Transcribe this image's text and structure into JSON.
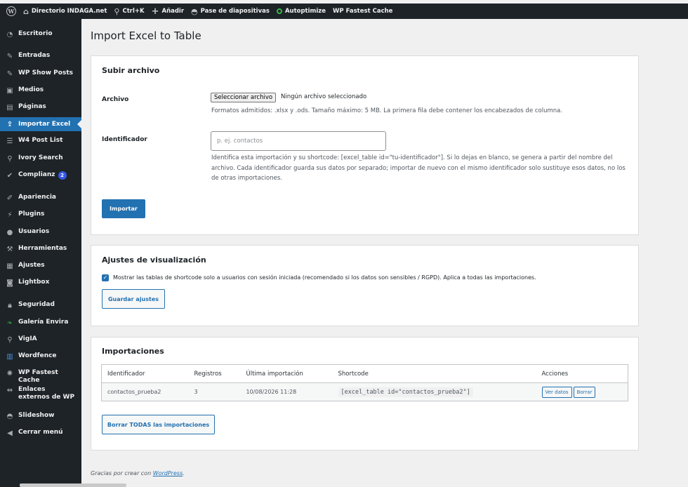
{
  "admin_bar": {
    "items": [
      {
        "icon": "home-icon",
        "label": "Directorio INDAGA.net"
      },
      {
        "icon": "search-icon",
        "label": "Ctrl+K"
      },
      {
        "icon": "plus-icon",
        "label": "Añadir"
      },
      {
        "icon": "slideshow-icon",
        "label": "Pase de diapositivas"
      },
      {
        "icon": "circle-icon",
        "label": "Autoptimize"
      },
      {
        "icon": "",
        "label": "WP Fastest Cache"
      }
    ]
  },
  "sidebar": {
    "items": [
      {
        "icon": "dashboard-icon",
        "label": "Escritorio"
      },
      {
        "icon": "pin-icon",
        "label": "Entradas"
      },
      {
        "icon": "pin-icon",
        "label": "WP Show Posts"
      },
      {
        "icon": "media-icon",
        "label": "Medios"
      },
      {
        "icon": "page-icon",
        "label": "Páginas"
      },
      {
        "icon": "upload-icon",
        "label": "Importar Excel"
      },
      {
        "icon": "list-icon",
        "label": "W4 Post List"
      },
      {
        "icon": "search-icon",
        "label": "Ivory Search"
      },
      {
        "icon": "check-icon",
        "label": "Complianz",
        "badge": "2"
      },
      {
        "icon": "brush-icon",
        "label": "Apariencia"
      },
      {
        "icon": "plug-icon",
        "label": "Plugins"
      },
      {
        "icon": "user-icon",
        "label": "Usuarios"
      },
      {
        "icon": "wrench-icon",
        "label": "Herramientas"
      },
      {
        "icon": "settings-icon",
        "label": "Ajustes"
      },
      {
        "icon": "lightbox-icon",
        "label": "Lightbox"
      },
      {
        "icon": "lock-icon",
        "label": "Seguridad"
      },
      {
        "icon": "leaf-icon",
        "label": "Galería Envira"
      },
      {
        "icon": "magnifier-icon",
        "label": "VigIA"
      },
      {
        "icon": "shield-icon",
        "label": "Wordfence"
      },
      {
        "icon": "cheetah-icon",
        "label": "WP Fastest Cache"
      },
      {
        "icon": "arrows-icon",
        "label": "Enlaces externos de WP"
      },
      {
        "icon": "slideshow-icon",
        "label": "Slideshow"
      },
      {
        "icon": "collapse-icon",
        "label": "Cerrar menú"
      }
    ]
  },
  "page": {
    "title": "Import Excel to Table"
  },
  "upload": {
    "heading": "Subir archivo",
    "file_label": "Archivo",
    "file_button": "Seleccionar archivo",
    "file_status": "Ningún archivo seleccionado",
    "file_help": "Formatos admitidos: .xlsx y .ods. Tamaño máximo: 5 MB. La primera fila debe contener los encabezados de columna.",
    "id_label": "Identificador",
    "id_placeholder": "p. ej. contactos",
    "id_value": "",
    "id_help": "Identifica esta importación y su shortcode: [excel_table id=\"tu-identificador\"]. Si lo dejas en blanco, se genera a partir del nombre del archivo. Cada identificador guarda sus datos por separado; importar de nuevo con el mismo identificador solo sustituye esos datos, no los de otras importaciones.",
    "submit": "Importar"
  },
  "display": {
    "heading": "Ajustes de visualización",
    "checkbox_checked": true,
    "checkbox_label": "Mostrar las tablas de shortcode solo a usuarios con sesión iniciada (recomendado si los datos son sensibles / RGPD). Aplica a todas las importaciones.",
    "save": "Guardar ajustes"
  },
  "imports": {
    "heading": "Importaciones",
    "columns": [
      "Identificador",
      "Registros",
      "Última importación",
      "Shortcode",
      "Acciones"
    ],
    "rows": [
      {
        "id": "contactos_prueba2",
        "records": "3",
        "date": "10/08/2026 11:28",
        "shortcode": "[excel_table id=\"contactos_prueba2\"]",
        "view": "Ver datos",
        "delete": "Borrar"
      }
    ],
    "delete_all": "Borrar TODAS las importaciones"
  },
  "footer": {
    "text": "Gracias por crear con ",
    "link": "WordPress",
    "suffix": "."
  }
}
